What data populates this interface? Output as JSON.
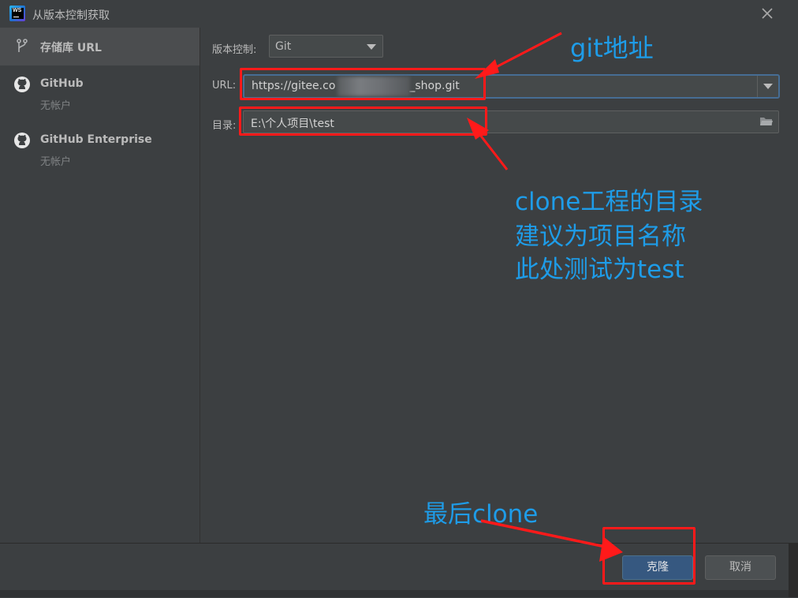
{
  "window": {
    "title": "从版本控制获取"
  },
  "sidebar": {
    "items": [
      {
        "label": "存储库 URL",
        "sublabel": "",
        "icon": "branch-icon",
        "selected": true
      },
      {
        "label": "GitHub",
        "sublabel": "无帐户",
        "icon": "github-icon",
        "selected": false
      },
      {
        "label": "GitHub Enterprise",
        "sublabel": "无帐户",
        "icon": "github-icon",
        "selected": false
      }
    ]
  },
  "form": {
    "vcs_label": "版本控制:",
    "vcs_value": "Git",
    "url_label": "URL:",
    "url_value_start": "https://gitee.co",
    "url_value_end": "_shop.git",
    "dir_label": "目录:",
    "dir_value": "E:\\个人项目\\test"
  },
  "buttons": {
    "clone": "克隆",
    "cancel": "取消"
  },
  "annotations": {
    "git_address": "git地址",
    "clone_dir_line1": "clone工程的目录",
    "clone_dir_line2": "建议为项目名称",
    "clone_dir_line3": "此处测试为test",
    "final_clone": "最后clone",
    "color": "#ff1a1a",
    "text_color": "#1e9ce8"
  }
}
